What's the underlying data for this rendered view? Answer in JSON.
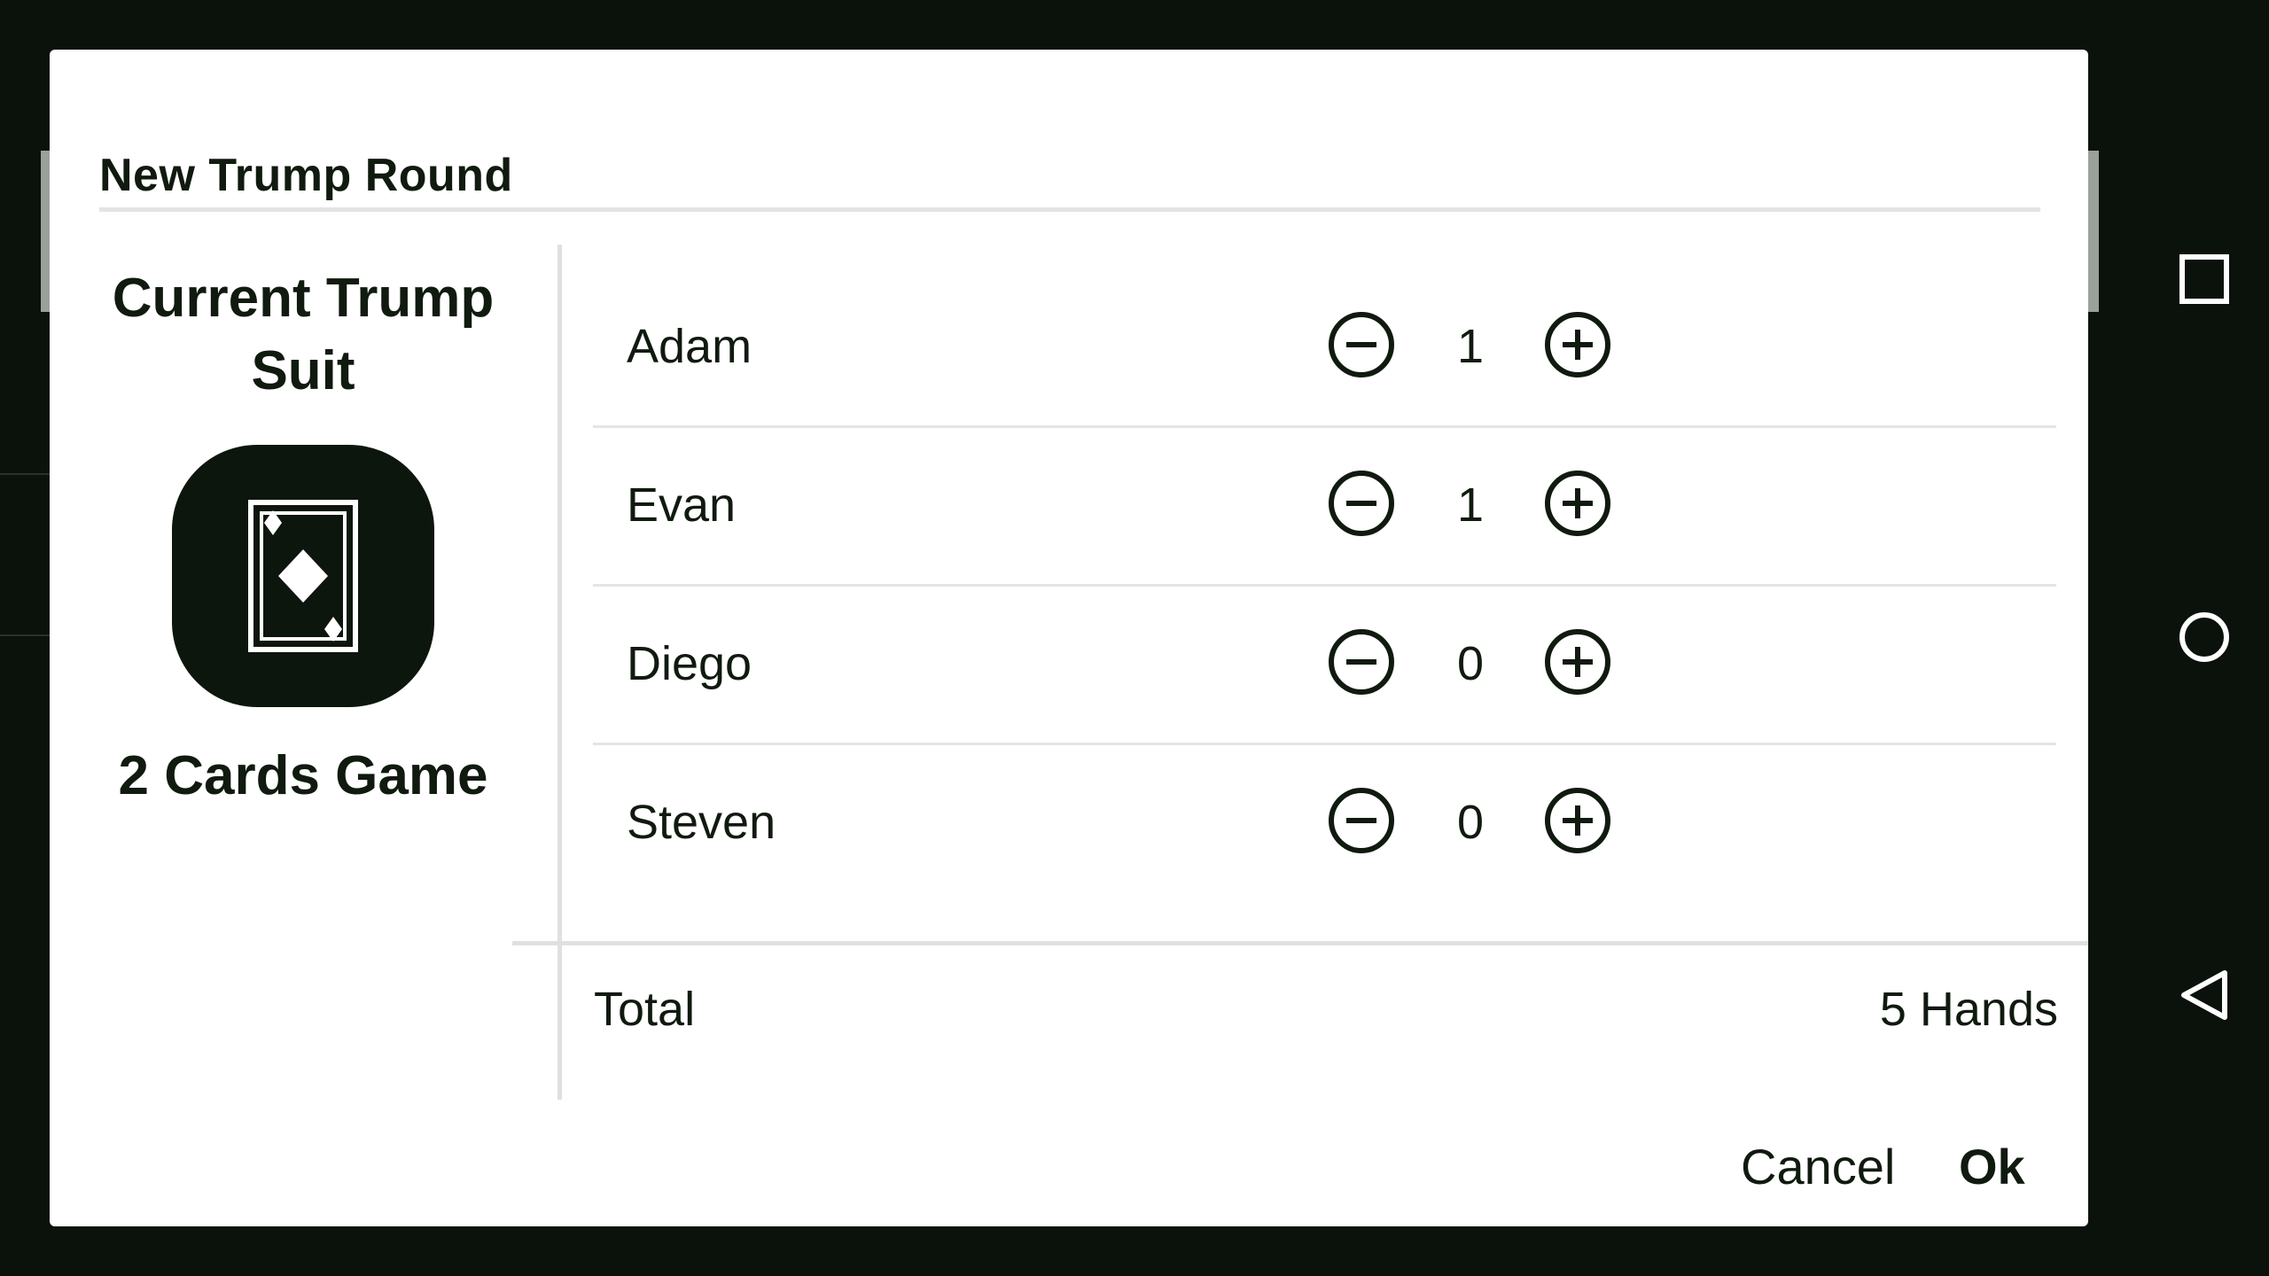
{
  "dialog": {
    "title": "New Trump Round",
    "trump_heading": "Current Trump Suit",
    "suit_icon": "diamond-card-icon",
    "game_label": "2 Cards Game",
    "players": [
      {
        "name": "Adam",
        "value": "1"
      },
      {
        "name": "Evan",
        "value": "1"
      },
      {
        "name": "Diego",
        "value": "0"
      },
      {
        "name": "Steven",
        "value": "0"
      }
    ],
    "total_label": "Total",
    "total_value": "5 Hands",
    "cancel_label": "Cancel",
    "ok_label": "Ok"
  },
  "nav": {
    "icons": [
      "recent-apps-icon",
      "home-icon",
      "back-icon"
    ]
  },
  "colors": {
    "dark": "#101a0f",
    "background": "#0b120b",
    "divider": "#e2e4e2",
    "surface": "#ffffff"
  }
}
